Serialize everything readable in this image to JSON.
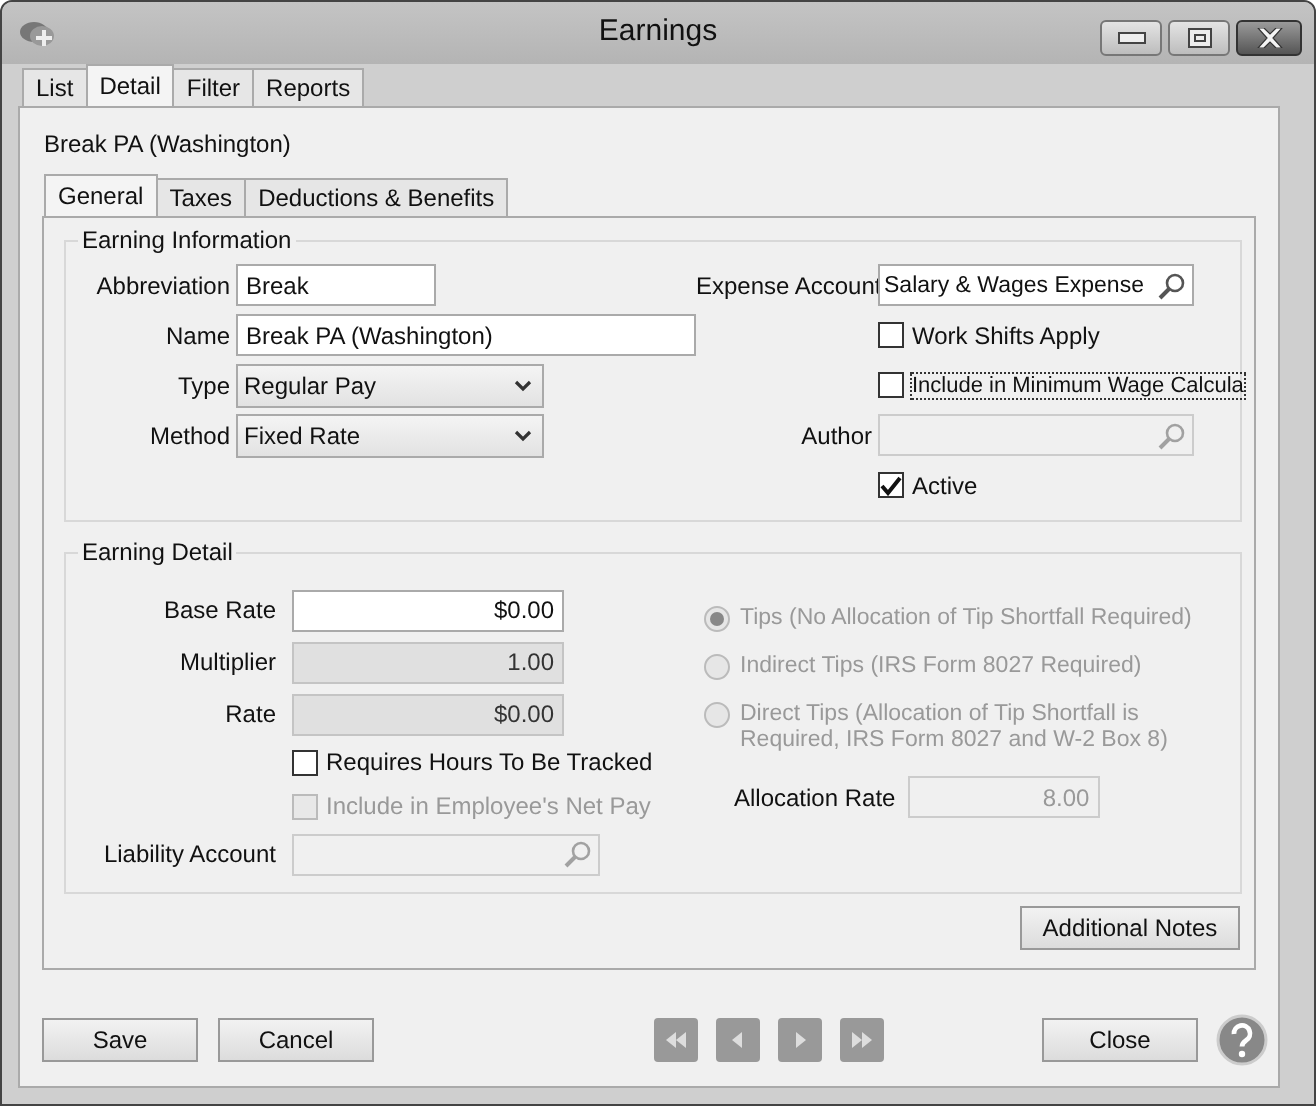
{
  "window": {
    "title": "Earnings"
  },
  "tabs": [
    {
      "label": "List",
      "selected": false
    },
    {
      "label": "Detail",
      "selected": true
    },
    {
      "label": "Filter",
      "selected": false
    },
    {
      "label": "Reports",
      "selected": false
    }
  ],
  "record_title": "Break PA (Washington)",
  "sub_tabs": [
    {
      "label": "General",
      "selected": true
    },
    {
      "label": "Taxes",
      "selected": false
    },
    {
      "label": "Deductions & Benefits",
      "selected": false
    }
  ],
  "earning_information": {
    "title": "Earning Information",
    "left_fields": [
      {
        "kind": "text",
        "label": "Abbreviation",
        "value": "Break",
        "wide": false
      },
      {
        "kind": "text",
        "label": "Name",
        "value": "Break PA (Washington)",
        "wide": true
      },
      {
        "kind": "select",
        "label": "Type",
        "value": "Regular Pay"
      },
      {
        "kind": "select",
        "label": "Method",
        "value": "Fixed Rate"
      }
    ],
    "right_fields": [
      {
        "kind": "lookup",
        "label": "Expense Account",
        "value": "Salary & Wages Expense",
        "disabled": false
      },
      {
        "kind": "checkbox",
        "label": "Work Shifts Apply",
        "checked": false,
        "focused": false
      },
      {
        "kind": "checkbox",
        "label": "Include in Minimum Wage Calcula",
        "checked": false,
        "focused": true
      },
      {
        "kind": "lookup",
        "label": "Author",
        "disabled": true
      },
      {
        "kind": "checkbox",
        "label": "Active",
        "checked": true,
        "focused": false
      }
    ]
  },
  "earning_detail": {
    "title": "Earning Detail",
    "fields": [
      {
        "label": "Base Rate",
        "value": "$0.00",
        "readonly": false
      },
      {
        "label": "Multiplier",
        "value": "1.00",
        "readonly": true
      },
      {
        "label": "Rate",
        "value": "$0.00",
        "readonly": true
      }
    ],
    "checkboxes": [
      {
        "label": "Requires Hours To Be Tracked",
        "checked": false,
        "disabled": false
      },
      {
        "label": "Include in Employee's Net Pay",
        "checked": false,
        "disabled": true
      }
    ],
    "liability_account": {
      "label": "Liability Account",
      "disabled": true
    },
    "tip_options": [
      {
        "label": "Tips (No Allocation of Tip Shortfall Required)",
        "selected": true,
        "disabled": true
      },
      {
        "label": "Indirect Tips (IRS Form 8027 Required)",
        "selected": false,
        "disabled": true
      },
      {
        "label": "Direct Tips (Allocation of Tip Shortfall is Required, IRS Form 8027 and W-2 Box 8)",
        "selected": false,
        "disabled": true
      }
    ],
    "allocation_rate": {
      "label": "Allocation Rate",
      "value": "8.00",
      "disabled": true
    }
  },
  "notes_button": "Additional Notes",
  "footer": {
    "left_buttons": [
      "Save",
      "Cancel"
    ],
    "close_button": "Close"
  }
}
